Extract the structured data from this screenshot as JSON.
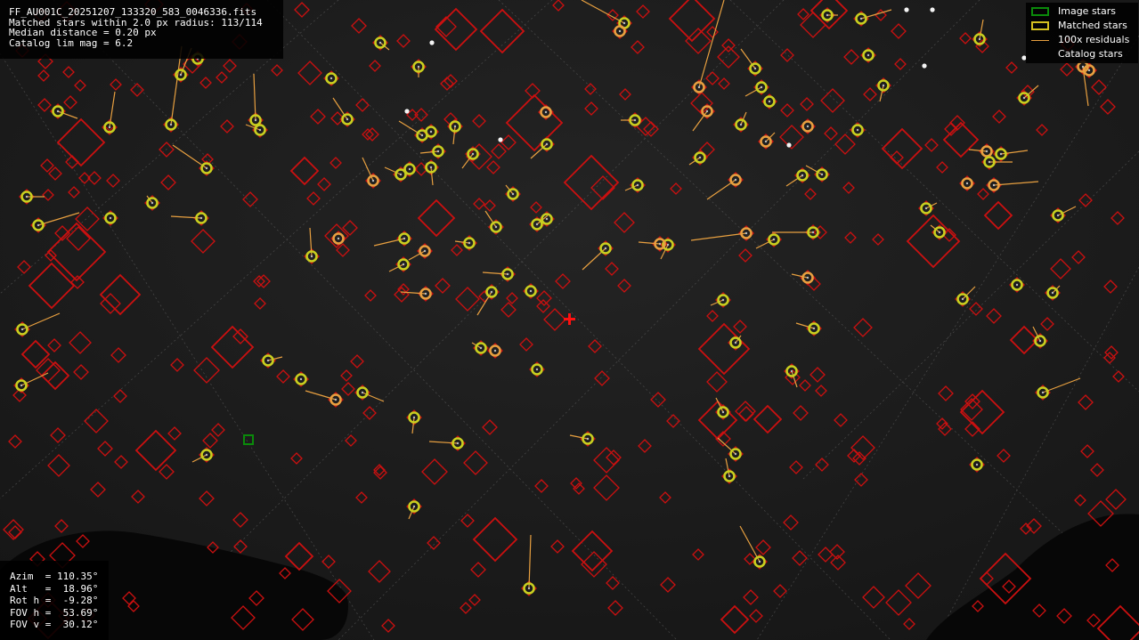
{
  "info": {
    "lines": [
      "FF_AU001C_20251207_133320_583_0046336.fits",
      "Matched stars within 2.0 px radius: 113/114",
      "Median distance = 0.20 px",
      "Catalog lim mag = 6.2"
    ]
  },
  "legend": {
    "items": [
      {
        "label": "Image stars",
        "color": "#0a8a0a"
      },
      {
        "label": "Matched stars",
        "color": "#d4c020"
      },
      {
        "label": "100x residuals",
        "color": "#e8a040"
      },
      {
        "label": "Catalog stars",
        "color": "#cc1010"
      }
    ]
  },
  "params": {
    "lines": [
      "Azim  = 110.35°",
      "Alt   =  18.96°",
      "Rot h =  -9.28°",
      "FOV h =  53.69°",
      "FOV v =  30.12°"
    ]
  },
  "colors": {
    "catalog": "#cc1010",
    "matched": "#c8d020",
    "residual": "#e8a040",
    "unmatched_image": "#0a8a0a",
    "grid": "#606060",
    "center_marker": "#ff1010"
  }
}
